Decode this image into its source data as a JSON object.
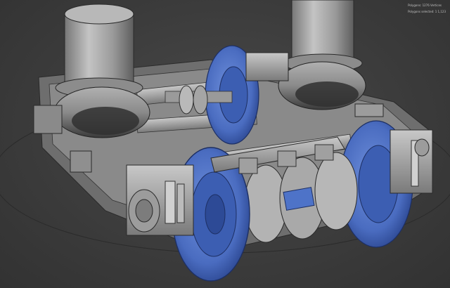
{
  "viewport": {
    "overlay_lines": [
      "Polygons: 1276  Vertices",
      "Polygons selected: 1 1,123"
    ]
  },
  "colors": {
    "background": "#3b3b3b",
    "wheel_blue": "#4e73c8",
    "wheel_blue_dark": "#2d4a96",
    "metal_gray": "#a8a8a8",
    "metal_dark": "#6b6b6b",
    "wire_line": "#2a2a2a"
  }
}
